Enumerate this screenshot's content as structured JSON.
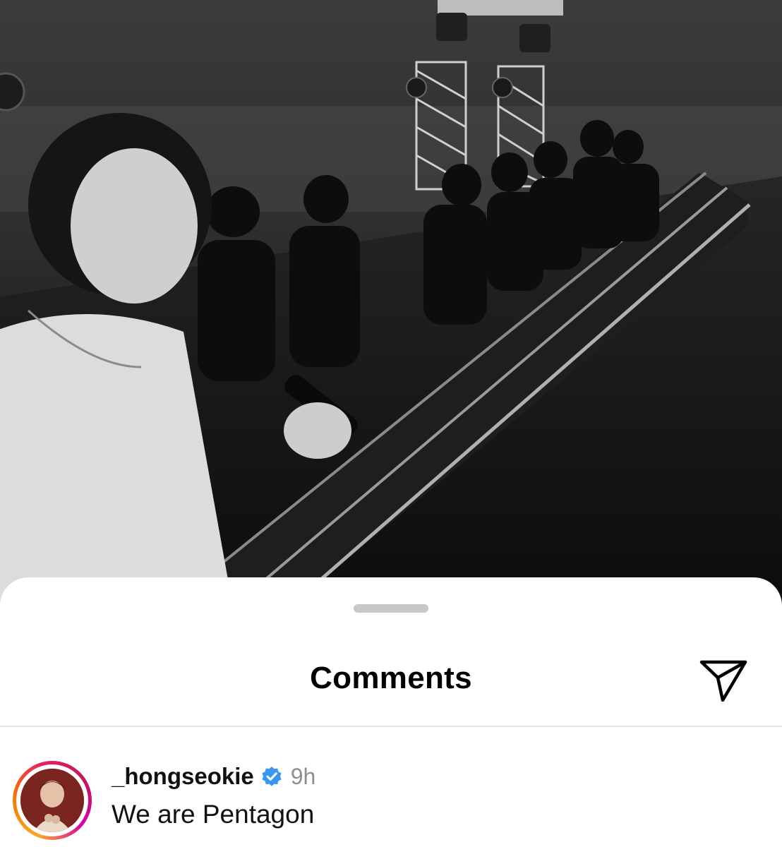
{
  "sheet": {
    "title": "Comments",
    "share_icon": "paper-plane-icon"
  },
  "comment": {
    "username": "_hongseokie",
    "verified_icon": "verified-badge-icon",
    "time": "9h",
    "text": "We are Pentagon"
  },
  "colors": {
    "verified": "#3897f0",
    "timestamp": "#8e8e8e",
    "divider": "#e3e3e3",
    "grabber": "#c7c7cc"
  }
}
